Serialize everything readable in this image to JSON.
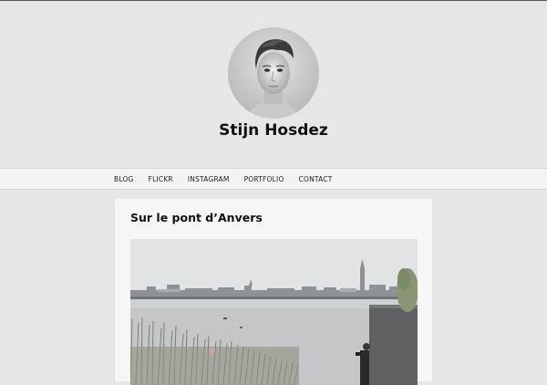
{
  "site": {
    "title": "Stijn Hosdez"
  },
  "nav": {
    "items": [
      {
        "label": "BLOG"
      },
      {
        "label": "FLICKR"
      },
      {
        "label": "INSTAGRAM"
      },
      {
        "label": "PORTFOLIO"
      },
      {
        "label": "CONTACT"
      }
    ]
  },
  "post": {
    "title": "Sur le pont d’Anvers"
  },
  "colors": {
    "page_bg": "#e6e6e6",
    "nav_bg": "#f3f3f3",
    "card_bg": "#f6f6f6"
  }
}
